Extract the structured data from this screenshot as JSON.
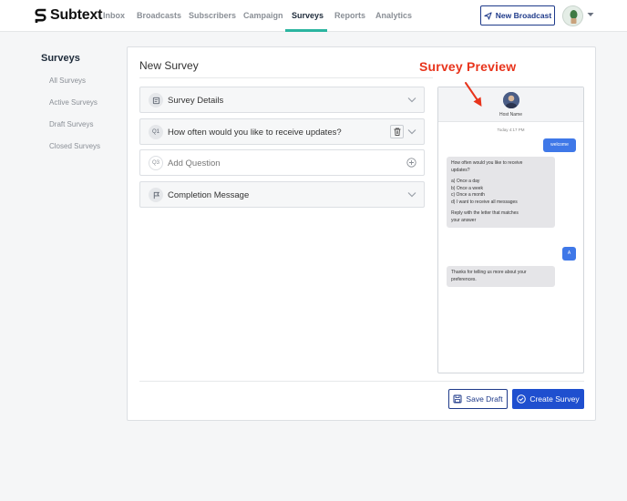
{
  "app": {
    "logo_text": "Subtext"
  },
  "nav": {
    "items": [
      {
        "label": "Inbox",
        "active": false
      },
      {
        "label": "Broadcasts",
        "active": false
      },
      {
        "label": "Subscribers",
        "active": false
      },
      {
        "label": "Campaign",
        "active": false
      },
      {
        "label": "Surveys",
        "active": true
      },
      {
        "label": "Reports",
        "active": false
      },
      {
        "label": "Analytics",
        "active": false
      }
    ],
    "new_broadcast_label": "New Broadcast"
  },
  "sidebar": {
    "title": "Surveys",
    "items": [
      {
        "label": "All Surveys"
      },
      {
        "label": "Active Surveys"
      },
      {
        "label": "Draft Surveys"
      },
      {
        "label": "Closed Surveys"
      }
    ]
  },
  "main": {
    "title": "New Survey",
    "preview_label": "Survey Preview",
    "sections": [
      {
        "icon": "survey-details-icon",
        "badge": "",
        "label": "Survey Details"
      },
      {
        "icon": "",
        "badge": "Q1",
        "label": "How often would you like to receive updates?"
      },
      {
        "icon": "",
        "badge": "Q3",
        "label": "Add Question"
      },
      {
        "icon": "flag-icon",
        "badge": "",
        "label": "Completion Message"
      }
    ],
    "save_draft_label": "Save Draft",
    "create_survey_label": "Create Survey"
  },
  "preview": {
    "host_name": "Host Name",
    "timestamp": "Today 4:17 PM",
    "messages": {
      "welcome": "welcome",
      "question_lines": [
        "How often would you like to receive",
        "updates?",
        "",
        "a) Once a day",
        "b) Once a week",
        "c) Once a month",
        "d) I want to receive all messages",
        "",
        "Reply with the letter that matches",
        "your answer"
      ],
      "reply": "A",
      "completion_lines": [
        "Thanks for telling us more about your",
        "preferences."
      ]
    }
  },
  "colors": {
    "accent_nav": "#2bb5a0",
    "primary": "#1f4fcf",
    "annotation": "#e8341c",
    "bubble_out": "#3f78e8"
  }
}
